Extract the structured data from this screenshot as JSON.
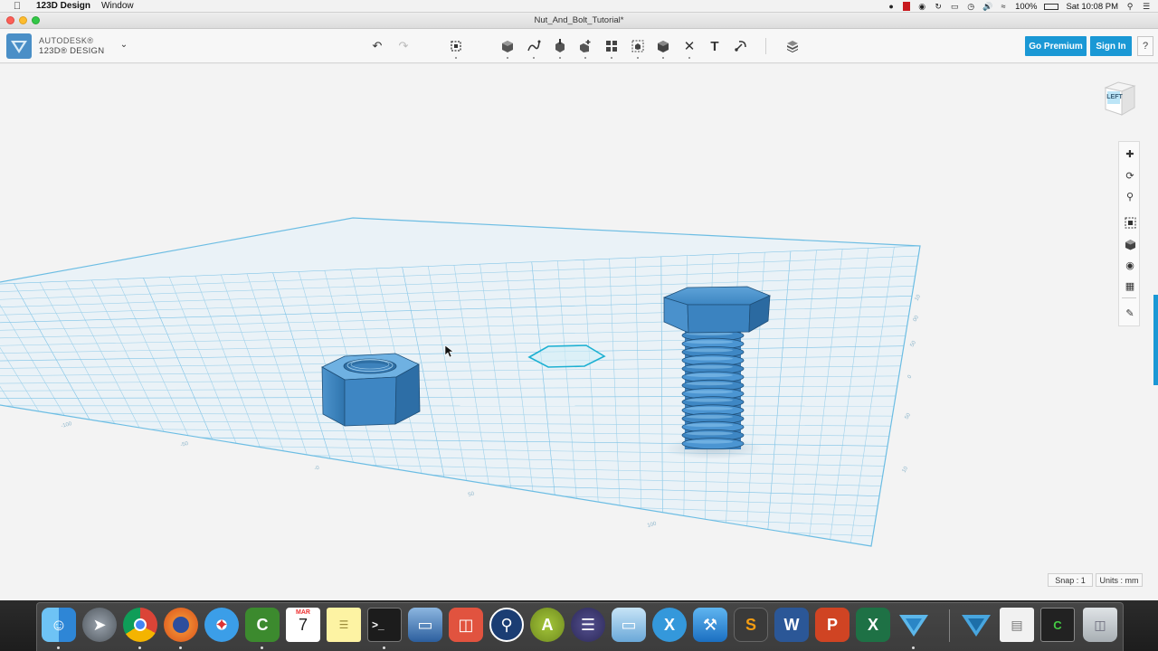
{
  "menubar": {
    "app_name": "123D Design",
    "menu_window": "Window",
    "battery": "100%",
    "clock": "Sat 10:08 PM"
  },
  "window": {
    "title": "Nut_And_Bolt_Tutorial*"
  },
  "toolbar": {
    "brand_line1": "AUTODESK®",
    "brand_line2": "123D® DESIGN",
    "go_premium_label": "Go Premium",
    "sign_in_label": "Sign In",
    "help_label": "?",
    "text_tool_glyph": "T"
  },
  "viewport": {
    "viewcube_label": "LEFT",
    "snap_label": "Snap : 1",
    "units_label": "Units : mm",
    "accent_color": "#1a98d5",
    "object_color": "#3f8cc6"
  },
  "dock": {
    "calendar_month": "MAR",
    "calendar_day": "7",
    "apps": [
      "Finder",
      "Launchpad",
      "Chrome",
      "Firefox",
      "Safari",
      "Camtasia",
      "Calendar",
      "Notes",
      "Terminal",
      "VirtualBox",
      "Remote Desktop",
      "SourceTree",
      "Android Studio",
      "Eclipse",
      "Cube",
      "Xamarin",
      "Xcode",
      "Sublime Text",
      "Word",
      "PowerPoint",
      "Excel",
      "123D Design",
      "123D",
      "Preview",
      "Camtasia Recorder",
      "Trash"
    ]
  }
}
